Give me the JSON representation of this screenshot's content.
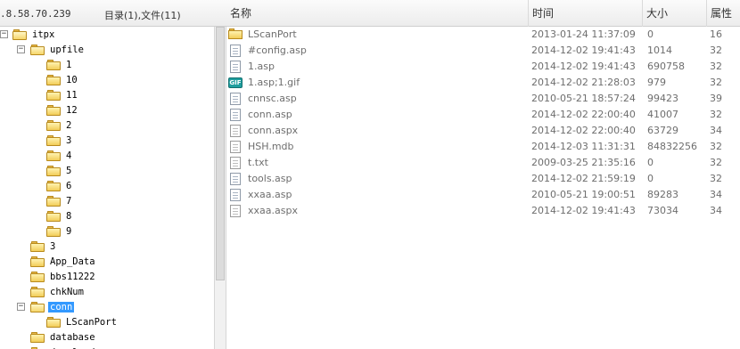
{
  "address": ".8.58.70.239",
  "counts_label": "目录(1),文件(11)",
  "columns": {
    "name": "名称",
    "time": "时间",
    "size": "大小",
    "attr": "属性"
  },
  "tree": [
    {
      "label": "itpx",
      "depth": 0,
      "toggle": "−",
      "open": true
    },
    {
      "label": "upfile",
      "depth": 1,
      "toggle": "−",
      "open": true
    },
    {
      "label": "1",
      "depth": 2
    },
    {
      "label": "10",
      "depth": 2
    },
    {
      "label": "11",
      "depth": 2
    },
    {
      "label": "12",
      "depth": 2
    },
    {
      "label": "2",
      "depth": 2
    },
    {
      "label": "3",
      "depth": 2
    },
    {
      "label": "4",
      "depth": 2
    },
    {
      "label": "5",
      "depth": 2
    },
    {
      "label": "6",
      "depth": 2
    },
    {
      "label": "7",
      "depth": 2
    },
    {
      "label": "8",
      "depth": 2
    },
    {
      "label": "9",
      "depth": 2
    },
    {
      "label": "3",
      "depth": 1
    },
    {
      "label": "App_Data",
      "depth": 1
    },
    {
      "label": "bbs11222",
      "depth": 1
    },
    {
      "label": "chkNum",
      "depth": 1
    },
    {
      "label": "conn",
      "depth": 1,
      "toggle": "−",
      "open": true,
      "selected": true
    },
    {
      "label": "LScanPort",
      "depth": 2
    },
    {
      "label": "database",
      "depth": 1
    },
    {
      "label": "download",
      "depth": 1
    }
  ],
  "files": [
    {
      "name": "LScanPort",
      "time": "2013-01-24 11:37:09",
      "size": "0",
      "attr": "16",
      "icon": "folder-icon"
    },
    {
      "name": "#config.asp",
      "time": "2014-12-02 19:41:43",
      "size": "1014",
      "attr": "32",
      "icon": "asp-file-icon"
    },
    {
      "name": "1.asp",
      "time": "2014-12-02 19:41:43",
      "size": "690758",
      "attr": "32",
      "icon": "asp-file-icon"
    },
    {
      "name": "1.asp;1.gif",
      "time": "2014-12-02 21:28:03",
      "size": "979",
      "attr": "32",
      "icon": "gif-file-icon"
    },
    {
      "name": "cnnsc.asp",
      "time": "2010-05-21 18:57:24",
      "size": "99423",
      "attr": "39",
      "icon": "asp-file-icon"
    },
    {
      "name": "conn.asp",
      "time": "2014-12-02 22:00:40",
      "size": "41007",
      "attr": "32",
      "icon": "asp-file-icon"
    },
    {
      "name": "conn.aspx",
      "time": "2014-12-02 22:00:40",
      "size": "63729",
      "attr": "34",
      "icon": "txt-file-icon"
    },
    {
      "name": "HSH.mdb",
      "time": "2014-12-03 11:31:31",
      "size": "84832256",
      "attr": "32",
      "icon": "txt-file-icon"
    },
    {
      "name": "t.txt",
      "time": "2009-03-25 21:35:16",
      "size": "0",
      "attr": "32",
      "icon": "txt-file-icon"
    },
    {
      "name": "tools.asp",
      "time": "2014-12-02 21:59:19",
      "size": "0",
      "attr": "32",
      "icon": "asp-file-icon"
    },
    {
      "name": "xxaa.asp",
      "time": "2010-05-21 19:00:51",
      "size": "89283",
      "attr": "34",
      "icon": "asp-file-icon"
    },
    {
      "name": "xxaa.aspx",
      "time": "2014-12-02 19:41:43",
      "size": "73034",
      "attr": "34",
      "icon": "txt-file-icon"
    }
  ],
  "colors": {
    "selection": "#3399ff",
    "folder": "#f2cd58",
    "gif_badge": "#1f9e9e"
  }
}
